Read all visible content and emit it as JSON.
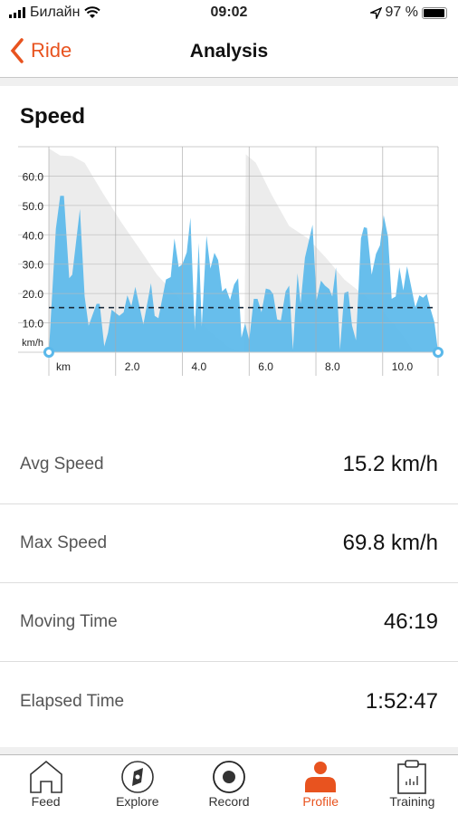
{
  "status_bar": {
    "carrier": "Билайн",
    "time": "09:02",
    "battery": "97 %",
    "battery_level": 0.97
  },
  "header": {
    "back_label": "Ride",
    "title": "Analysis"
  },
  "section_title": "Speed",
  "colors": {
    "accent": "#e8531f",
    "speed_fill": "#5ab8ea",
    "elevation_fill": "#ececec",
    "avg_line": "#1a2a3a"
  },
  "chart_data": {
    "type": "area",
    "title": "Speed",
    "xlabel": "km",
    "ylabel": "km/h",
    "xlim": [
      0,
      11.66
    ],
    "ylim": [
      0,
      70
    ],
    "x_ticks": [
      2,
      4,
      6,
      8,
      10
    ],
    "x_tick_labels": [
      "km",
      "2.0",
      "4.0",
      "6.0",
      "8.0",
      "10.0"
    ],
    "y_ticks": [
      10,
      20,
      30,
      40,
      50,
      60
    ],
    "y_tick_labels": [
      "10.0",
      "20.0",
      "30.0",
      "40.0",
      "50.0",
      "60.0"
    ],
    "grid": true,
    "average_speed": 15.2,
    "speed": {
      "x": [
        0,
        0.21,
        0.34,
        0.45,
        0.61,
        0.7,
        0.93,
        1.07,
        1.19,
        1.43,
        1.52,
        1.66,
        1.77,
        1.88,
        2.11,
        2.24,
        2.35,
        2.47,
        2.59,
        2.83,
        3.06,
        3.17,
        3.28,
        3.51,
        3.65,
        3.76,
        3.89,
        4.0,
        4.13,
        4.24,
        4.37,
        4.49,
        4.58,
        4.72,
        4.84,
        4.96,
        5.07,
        5.19,
        5.3,
        5.43,
        5.55,
        5.67,
        5.77,
        5.88,
        6.0,
        6.14,
        6.25,
        6.37,
        6.5,
        6.62,
        6.72,
        6.84,
        6.95,
        7.09,
        7.2,
        7.31,
        7.45,
        7.54,
        7.67,
        7.9,
        8.02,
        8.15,
        8.27,
        8.4,
        8.49,
        8.6,
        8.72,
        8.85,
        8.97,
        9.08,
        9.2,
        9.35,
        9.44,
        9.53,
        9.67,
        9.8,
        9.92,
        10.03,
        10.16,
        10.27,
        10.39,
        10.5,
        10.62,
        10.73,
        10.84,
        10.98,
        11.1,
        11.21,
        11.32,
        11.43,
        11.55,
        11.66
      ],
      "y": [
        0,
        42,
        53.3,
        53.3,
        25.2,
        26.4,
        48.8,
        19,
        9,
        16.5,
        16.5,
        2,
        6.6,
        14.5,
        12.4,
        13.6,
        19.4,
        15.7,
        22.3,
        9.5,
        23.5,
        12.4,
        11.6,
        24.8,
        25.6,
        38.8,
        29,
        30,
        34,
        45.9,
        7.4,
        37.2,
        8.7,
        39.7,
        28.5,
        33.9,
        31.4,
        20.7,
        21.9,
        17.8,
        23.1,
        25.2,
        5,
        9.9,
        4.1,
        18.2,
        18.2,
        13.6,
        21.7,
        21.3,
        19.8,
        11.2,
        10.9,
        20.7,
        22.7,
        0.8,
        26.9,
        16.5,
        32.2,
        43.4,
        17.8,
        24.4,
        22.7,
        21.5,
        19,
        28.9,
        0.8,
        20.2,
        20.7,
        9.1,
        4.1,
        38.8,
        42.6,
        42.3,
        26.4,
        33.5,
        36.4,
        46.7,
        39.3,
        18.2,
        19,
        28.9,
        21.1,
        29.3,
        23.1,
        15.3,
        19.4,
        18.6,
        19.8,
        14.9,
        10.3,
        0
      ]
    },
    "elevation_profile": {
      "x": [
        0,
        0.34,
        0.7,
        1.07,
        1.6,
        2.15,
        2.7,
        3.24,
        3.78,
        4.3,
        4.87,
        5.4,
        5.86,
        5.9,
        6.2,
        6.67,
        7.2,
        7.76,
        8.3,
        8.85,
        9.4,
        9.94,
        10.5,
        10.9,
        11.66
      ],
      "y": [
        69.4,
        67,
        66.8,
        64.5,
        54.5,
        44.6,
        35.5,
        26.4,
        19.8,
        13.2,
        6.6,
        1.6,
        0,
        67.4,
        64.5,
        53.7,
        43,
        38.8,
        32.2,
        24.8,
        19.8,
        14.9,
        7.4,
        0.8,
        0
      ]
    }
  },
  "stats": [
    {
      "label": "Avg Speed",
      "value": "15.2 km/h"
    },
    {
      "label": "Max Speed",
      "value": "69.8 km/h"
    },
    {
      "label": "Moving Time",
      "value": "46:19"
    },
    {
      "label": "Elapsed Time",
      "value": "1:52:47"
    }
  ],
  "tabs": [
    {
      "label": "Feed",
      "icon": "home-icon"
    },
    {
      "label": "Explore",
      "icon": "compass-icon"
    },
    {
      "label": "Record",
      "icon": "record-icon"
    },
    {
      "label": "Profile",
      "icon": "person-icon",
      "active": true
    },
    {
      "label": "Training",
      "icon": "clipboard-chart-icon"
    }
  ]
}
